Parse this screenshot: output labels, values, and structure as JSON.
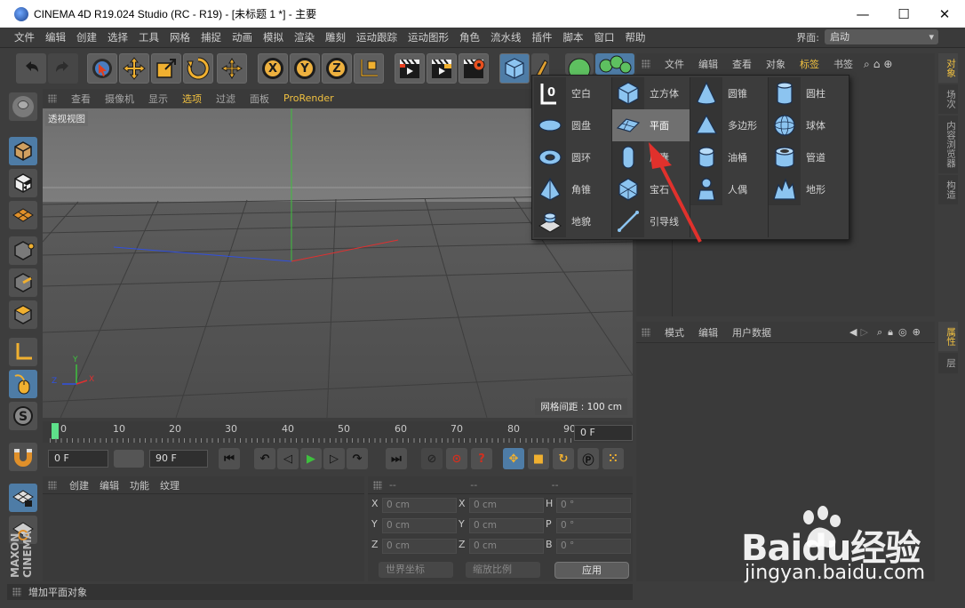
{
  "window": {
    "title": "CINEMA 4D R19.024 Studio (RC - R19) - [未标题 1 *] - 主要",
    "minimize": "—",
    "maximize": "☐",
    "close": "✕"
  },
  "menubar": {
    "items": [
      "文件",
      "编辑",
      "创建",
      "选择",
      "工具",
      "网格",
      "捕捉",
      "动画",
      "模拟",
      "渲染",
      "雕刻",
      "运动跟踪",
      "运动图形",
      "角色",
      "流水线",
      "插件",
      "脚本",
      "窗口",
      "帮助"
    ],
    "layout_label": "界面:",
    "layout_value": "启动"
  },
  "toolbar": {
    "axis_x": "X",
    "axis_y": "Y",
    "axis_z": "Z"
  },
  "viewport": {
    "menu": [
      "查看",
      "摄像机",
      "显示",
      "选项",
      "过滤",
      "面板",
      "ProRender"
    ],
    "label": "透视视图",
    "grid_spacing": "网格间距 : 100 cm",
    "axis_y": "Y",
    "axis_x": "X",
    "axis_z": "Z"
  },
  "timeline": {
    "ticks": [
      "0",
      "10",
      "20",
      "30",
      "40",
      "50",
      "60",
      "70",
      "80",
      "90"
    ],
    "current_frame": "0 F"
  },
  "playback": {
    "start": "0 F",
    "end": "90 F"
  },
  "materials": {
    "menu": [
      "创建",
      "编辑",
      "功能",
      "纹理"
    ]
  },
  "coordinates": {
    "headers": [
      "--",
      "--",
      "--"
    ],
    "rows": [
      {
        "a": "X",
        "av": "0 cm",
        "b": "X",
        "bv": "0 cm",
        "c": "H",
        "cv": "0 °"
      },
      {
        "a": "Y",
        "av": "0 cm",
        "b": "Y",
        "bv": "0 cm",
        "c": "P",
        "cv": "0 °"
      },
      {
        "a": "Z",
        "av": "0 cm",
        "b": "Z",
        "bv": "0 cm",
        "c": "B",
        "cv": "0 °"
      }
    ],
    "world_coords": "世界坐标",
    "scale": "缩放比例",
    "apply": "应用"
  },
  "status": "增加平面对象",
  "object_manager": {
    "menu": [
      "文件",
      "编辑",
      "查看",
      "对象",
      "标签",
      "书签"
    ]
  },
  "attribute_manager": {
    "menu": [
      "模式",
      "编辑",
      "用户数据"
    ]
  },
  "right_tabs_top": [
    "对象",
    "场次",
    "内容浏览器",
    "构造"
  ],
  "right_tabs_bottom": [
    "属性",
    "层"
  ],
  "palette": {
    "items": [
      {
        "label": "空白",
        "icon": "null-icon"
      },
      {
        "label": "立方体",
        "icon": "cube-icon"
      },
      {
        "label": "圆锥",
        "icon": "cone-icon"
      },
      {
        "label": "圆柱",
        "icon": "cylinder-icon"
      },
      {
        "label": "圆盘",
        "icon": "disc-icon"
      },
      {
        "label": "平面",
        "icon": "plane-icon"
      },
      {
        "label": "多边形",
        "icon": "polygon-icon"
      },
      {
        "label": "球体",
        "icon": "sphere-icon"
      },
      {
        "label": "圆环",
        "icon": "torus-icon"
      },
      {
        "label": "胶囊",
        "icon": "capsule-icon"
      },
      {
        "label": "油桶",
        "icon": "oil-tank-icon"
      },
      {
        "label": "管道",
        "icon": "tube-icon"
      },
      {
        "label": "角锥",
        "icon": "pyramid-icon"
      },
      {
        "label": "宝石",
        "icon": "gem-icon"
      },
      {
        "label": "人偶",
        "icon": "figure-icon"
      },
      {
        "label": "地形",
        "icon": "landscape-icon"
      },
      {
        "label": "地貌",
        "icon": "relief-icon"
      },
      {
        "label": "引导线",
        "icon": "guide-icon"
      }
    ],
    "selected": "平面"
  },
  "watermark": {
    "brand": "Baidu经验",
    "url": "jingyan.baidu.com"
  },
  "colors": {
    "accent": "#f0c040",
    "selection": "#4e7ca6",
    "primitive_blue": "#6aaee6",
    "annotation_arrow": "#e0312c"
  }
}
